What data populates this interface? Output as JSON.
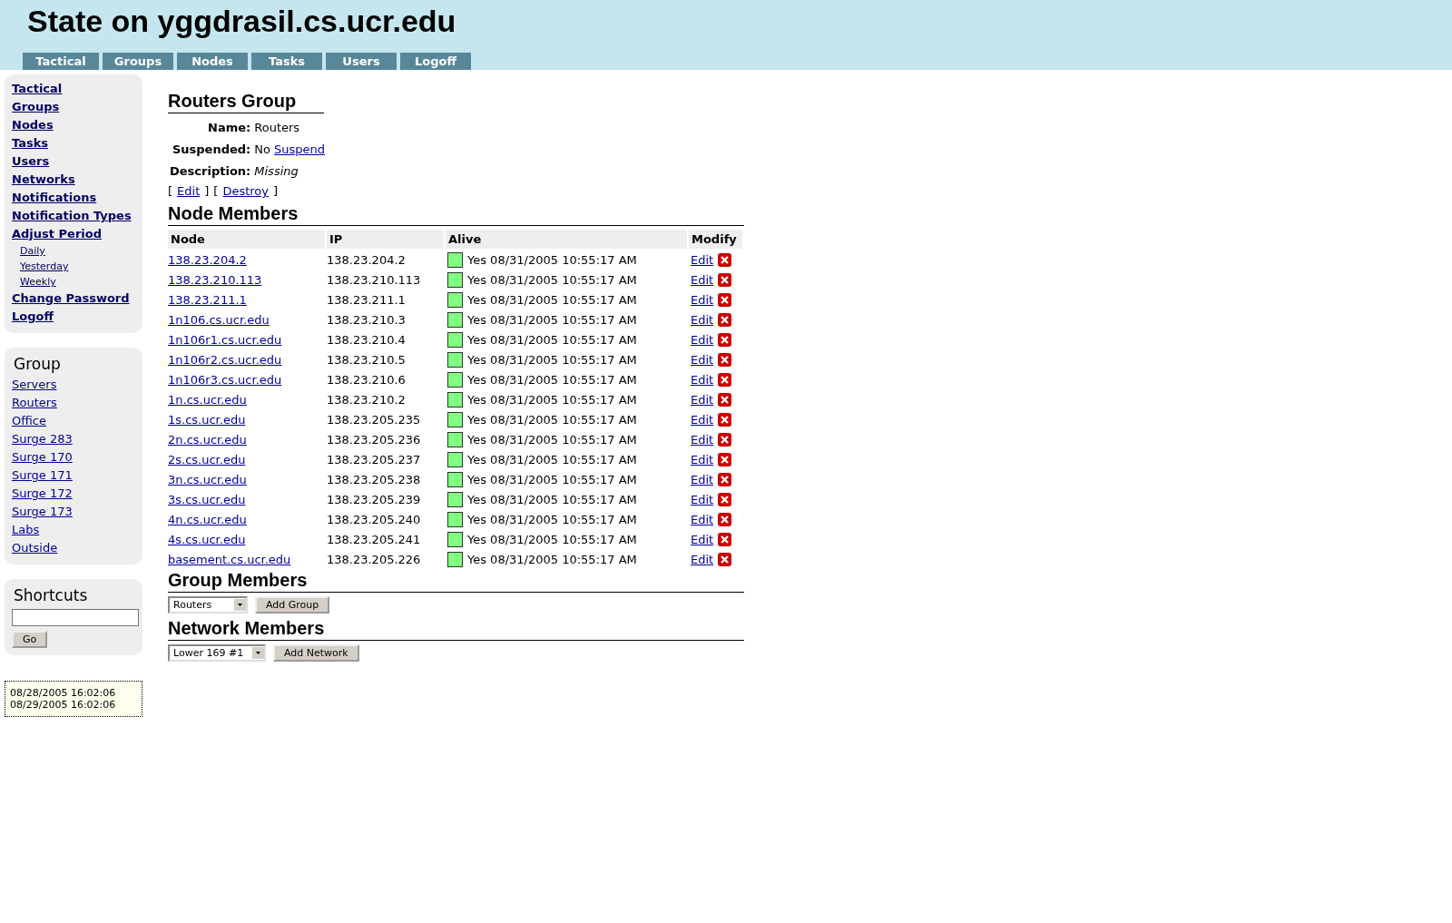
{
  "header": {
    "title": "State on yggdrasil.cs.ucr.edu",
    "tabs": [
      "Tactical",
      "Groups",
      "Nodes",
      "Tasks",
      "Users",
      "Logoff"
    ]
  },
  "sidebar": {
    "menu": [
      {
        "label": "Tactical"
      },
      {
        "label": "Groups"
      },
      {
        "label": "Nodes"
      },
      {
        "label": "Tasks"
      },
      {
        "label": "Users"
      },
      {
        "label": "Networks"
      },
      {
        "label": "Notifications"
      },
      {
        "label": "Notification Types"
      },
      {
        "label": "Adjust Period",
        "children": [
          {
            "label": "Daily"
          },
          {
            "label": "Yesterday"
          },
          {
            "label": "Weekly"
          }
        ]
      },
      {
        "label": "Change Password"
      },
      {
        "label": "Logoff"
      }
    ],
    "group_box": {
      "title": "Group",
      "items": [
        "Servers",
        "Routers",
        "Office",
        "Surge 283",
        "Surge 170",
        "Surge 171",
        "Surge 172",
        "Surge 173",
        "Labs",
        "Outside"
      ]
    },
    "shortcuts": {
      "title": "Shortcuts",
      "button": "Go"
    },
    "period": [
      "08/28/2005 16:02:06",
      "08/29/2005 16:02:06"
    ]
  },
  "group": {
    "title": "Routers Group",
    "fields": [
      {
        "label": "Name:",
        "value": "Routers"
      },
      {
        "label": "Suspended:",
        "value": "No",
        "link": "Suspend"
      },
      {
        "label": "Description:",
        "value": "Missing",
        "italic": true
      }
    ],
    "actions": [
      {
        "open": "[",
        "label": "Edit",
        "close": "]"
      },
      {
        "open": "[",
        "label": "Destroy",
        "close": "]"
      }
    ]
  },
  "node_members": {
    "title": "Node Members",
    "columns": [
      "Node",
      "IP",
      "Alive",
      "Modify"
    ],
    "rows": [
      {
        "node": "138.23.204.2",
        "ip": "138.23.204.2",
        "color": "#80ff80",
        "alive": "Yes 08/31/2005 10:55:17 AM",
        "edit": "Edit"
      },
      {
        "node": "138.23.210.113",
        "ip": "138.23.210.113",
        "color": "#80ff80",
        "alive": "Yes 08/31/2005 10:55:17 AM",
        "edit": "Edit"
      },
      {
        "node": "138.23.211.1",
        "ip": "138.23.211.1",
        "color": "#80ff80",
        "alive": "Yes 08/31/2005 10:55:17 AM",
        "edit": "Edit"
      },
      {
        "node": "1n106.cs.ucr.edu",
        "ip": "138.23.210.3",
        "color": "#80ff80",
        "alive": "Yes 08/31/2005 10:55:17 AM",
        "edit": "Edit"
      },
      {
        "node": "1n106r1.cs.ucr.edu",
        "ip": "138.23.210.4",
        "color": "#80ff80",
        "alive": "Yes 08/31/2005 10:55:17 AM",
        "edit": "Edit"
      },
      {
        "node": "1n106r2.cs.ucr.edu",
        "ip": "138.23.210.5",
        "color": "#80ff80",
        "alive": "Yes 08/31/2005 10:55:17 AM",
        "edit": "Edit"
      },
      {
        "node": "1n106r3.cs.ucr.edu",
        "ip": "138.23.210.6",
        "color": "#80ff80",
        "alive": "Yes 08/31/2005 10:55:17 AM",
        "edit": "Edit"
      },
      {
        "node": "1n.cs.ucr.edu",
        "ip": "138.23.210.2",
        "color": "#80ff80",
        "alive": "Yes 08/31/2005 10:55:17 AM",
        "edit": "Edit"
      },
      {
        "node": "1s.cs.ucr.edu",
        "ip": "138.23.205.235",
        "color": "#80ff80",
        "alive": "Yes 08/31/2005 10:55:17 AM",
        "edit": "Edit"
      },
      {
        "node": "2n.cs.ucr.edu",
        "ip": "138.23.205.236",
        "color": "#80ff80",
        "alive": "Yes 08/31/2005 10:55:17 AM",
        "edit": "Edit"
      },
      {
        "node": "2s.cs.ucr.edu",
        "ip": "138.23.205.237",
        "color": "#80ff80",
        "alive": "Yes 08/31/2005 10:55:17 AM",
        "edit": "Edit"
      },
      {
        "node": "3n.cs.ucr.edu",
        "ip": "138.23.205.238",
        "color": "#80ff80",
        "alive": "Yes 08/31/2005 10:55:17 AM",
        "edit": "Edit"
      },
      {
        "node": "3s.cs.ucr.edu",
        "ip": "138.23.205.239",
        "color": "#80ff80",
        "alive": "Yes 08/31/2005 10:55:17 AM",
        "edit": "Edit"
      },
      {
        "node": "4n.cs.ucr.edu",
        "ip": "138.23.205.240",
        "color": "#80ff80",
        "alive": "Yes 08/31/2005 10:55:17 AM",
        "edit": "Edit"
      },
      {
        "node": "4s.cs.ucr.edu",
        "ip": "138.23.205.241",
        "color": "#80ff80",
        "alive": "Yes 08/31/2005 10:55:17 AM",
        "edit": "Edit"
      },
      {
        "node": "basement.cs.ucr.edu",
        "ip": "138.23.205.226",
        "color": "#80ff80",
        "alive": "Yes 08/31/2005 10:55:17 AM",
        "edit": "Edit"
      }
    ]
  },
  "group_members": {
    "title": "Group Members",
    "select": "Routers",
    "button": "Add Group"
  },
  "network_members": {
    "title": "Network Members",
    "select": "Lower 169 #1",
    "button": "Add Network"
  }
}
